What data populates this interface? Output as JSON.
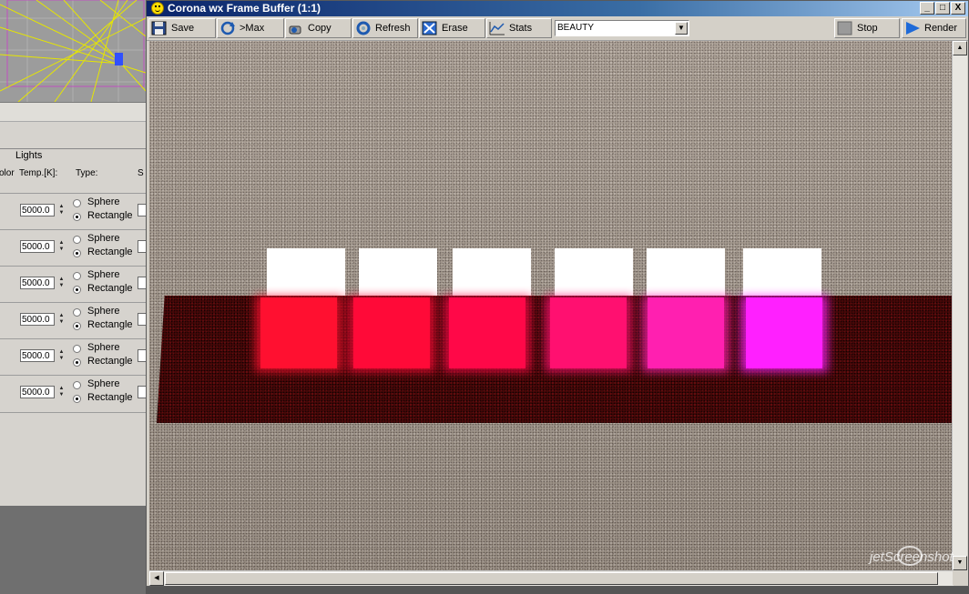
{
  "window": {
    "title": "Corona wx Frame Buffer (1:1)"
  },
  "window_controls": {
    "minimize": "_",
    "maximize": "□",
    "close": "X"
  },
  "toolbar": {
    "save_label": "Save",
    "max_label": ">Max",
    "copy_label": "Copy",
    "refresh_label": "Refresh",
    "erase_label": "Erase",
    "stats_label": "Stats",
    "pass_select_value": "BEAUTY",
    "stop_label": "Stop",
    "render_label": "Render"
  },
  "lights_panel": {
    "title": "Lights",
    "header_color": "olor",
    "header_temp": "Temp.[K]:",
    "header_type": "Type:",
    "header_sp": "S",
    "rows": [
      {
        "temp": "5000.0",
        "option1": "Sphere",
        "option2": "Rectangle",
        "selected": "Rectangle"
      },
      {
        "temp": "5000.0",
        "option1": "Sphere",
        "option2": "Rectangle",
        "selected": "Rectangle"
      },
      {
        "temp": "5000.0",
        "option1": "Sphere",
        "option2": "Rectangle",
        "selected": "Rectangle"
      },
      {
        "temp": "5000.0",
        "option1": "Sphere",
        "option2": "Rectangle",
        "selected": "Rectangle"
      },
      {
        "temp": "5000.0",
        "option1": "Sphere",
        "option2": "Rectangle",
        "selected": "Rectangle"
      },
      {
        "temp": "5000.0",
        "option1": "Sphere",
        "option2": "Rectangle",
        "selected": "Rectangle"
      }
    ]
  },
  "render": {
    "light_colors": [
      "#ff1030",
      "#ff0a38",
      "#ff0848",
      "#ff1070",
      "#ff20b0",
      "#ff20ff"
    ]
  },
  "watermark": {
    "text": "jetScreenshot"
  },
  "colors": {
    "title_bar": "#0a246a",
    "render_bg": "#a59a8e",
    "strip": "#4a0808"
  }
}
